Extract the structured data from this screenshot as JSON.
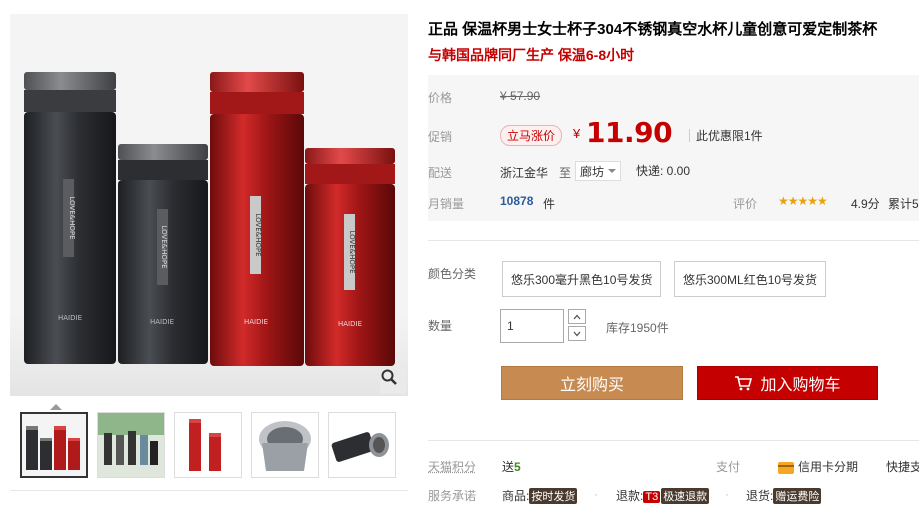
{
  "product": {
    "title": "正品 保温杯男士女士杯子304不锈钢真空水杯儿童创意可爱定制茶杯",
    "subtitle": "与韩国品牌同厂生产 保温6-8小时"
  },
  "gallery": {
    "brand_text": "LOVE&HOPE",
    "model_text": "HAIDIE",
    "thumbnail_count": 5
  },
  "price": {
    "label": "价格",
    "currency": "¥",
    "original": "57.90"
  },
  "promo": {
    "label": "促销",
    "tag": "立马涨价",
    "currency": "¥",
    "price": "11.90",
    "limit": "此优惠限1件"
  },
  "shipping": {
    "label": "配送",
    "origin": "浙江金华",
    "to": "至",
    "destination": "廊坊",
    "express": "快递: 0.00"
  },
  "sales": {
    "label": "月销量",
    "count": "10878",
    "unit": "件"
  },
  "rating": {
    "label": "评价",
    "stars": "★★★★★",
    "score": "4.9分",
    "total": "累计5"
  },
  "color": {
    "label": "颜色分类",
    "options": [
      "悠乐300毫升黑色10号发货",
      "悠乐300ML红色10号发货"
    ]
  },
  "quantity": {
    "label": "数量",
    "value": "1",
    "stock": "库存1950件"
  },
  "buttons": {
    "buy_now": "立刻购买",
    "add_cart": "加入购物车"
  },
  "points": {
    "label": "天猫积分",
    "value_prefix": "送",
    "value": "5"
  },
  "payment": {
    "label": "支付",
    "credit": "信用卡分期",
    "quick": "快捷支"
  },
  "service": {
    "label": "服务承诺",
    "goods_label": "商品:",
    "goods_tag": "按时发货",
    "refund_label": "退款:",
    "refund_t3": "T3",
    "refund_tag": "极速退款",
    "return_label": "退货:",
    "return_tag": "赠运费险"
  },
  "colors": {
    "accent_red": "#c40000",
    "buy_button": "#c78a50",
    "link_blue": "#2b5b9a",
    "star_yellow": "#e8a20c"
  }
}
